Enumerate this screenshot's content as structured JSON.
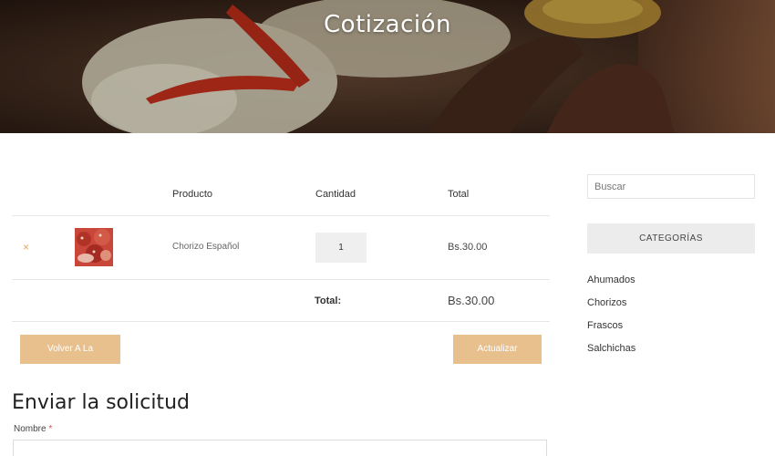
{
  "hero": {
    "title": "Cotización"
  },
  "table": {
    "headers": [
      "Producto",
      "Cantidad",
      "Total"
    ],
    "items": [
      {
        "remove": "×",
        "name": "Chorizo Español",
        "quantity": "1",
        "total": "Bs.30.00"
      }
    ],
    "total_label": "Total:",
    "total_value": "Bs.30.00"
  },
  "buttons": {
    "shop": "Volver A La Tienda",
    "update": "Actualizar Lista"
  },
  "form": {
    "title": "Enviar la solicitud",
    "name_label": "Nombre",
    "required_mark": "*"
  },
  "sidebar": {
    "search_placeholder": "Buscar",
    "categories_title": "CATEGORÍAS",
    "categories": [
      "Ahumados",
      "Chorizos",
      "Frascos",
      "Salchichas"
    ]
  },
  "colors": {
    "accent": "#e8c08d",
    "remove": "#e8a860"
  }
}
